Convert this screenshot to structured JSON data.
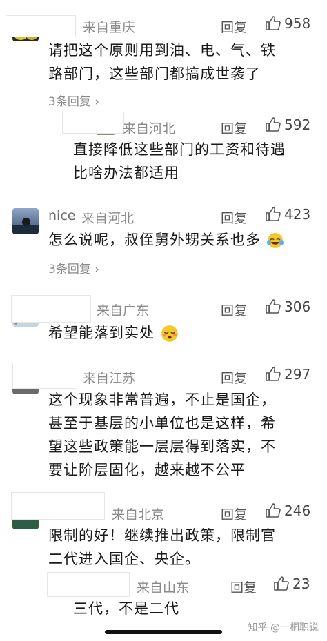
{
  "comments": [
    {
      "location": "来自重庆",
      "reply": "回复",
      "likes": "958",
      "lines": [
        "请把这个原则用到油、电、气、铁",
        "路部门，这些部门都搞成世袭了"
      ],
      "more": "3条回复 ›"
    },
    {
      "location": "来自河北",
      "reply": "回复",
      "likes": "592",
      "lines": [
        "直接降低这些部门的工资和待遇",
        "比啥办法都适用"
      ]
    },
    {
      "name": "nice",
      "location": "来自河北",
      "reply": "回复",
      "likes": "423",
      "lines": [
        "怎么说呢，叔侄舅外甥关系也多"
      ],
      "more": "3条回复 ›"
    },
    {
      "location": "来自广东",
      "reply": "回复",
      "likes": "306",
      "lines": [
        "希望能落到实处"
      ]
    },
    {
      "location": "来自江苏",
      "reply": "回复",
      "likes": "297",
      "lines": [
        "这个现象非常普遍，不止是国企，",
        "甚至于基层的小单位也是这样，希",
        "望这些政策能一层层得到落实，不",
        "要让阶层固化，越来越不公平"
      ]
    },
    {
      "location": "来自北京",
      "reply": "回复",
      "likes": "246",
      "lines": [
        "限制的好！继续推出政策，限制官",
        "二代进入国企、央企。"
      ]
    },
    {
      "location": "来自山东",
      "reply": "回复",
      "likes": "23",
      "lines": [
        "三代，不是二代"
      ]
    }
  ],
  "watermark": "知乎 @一桐职说",
  "colors": {
    "text": "#1a1a1a",
    "meta": "#8a8a8a",
    "background": "#ffffff"
  }
}
